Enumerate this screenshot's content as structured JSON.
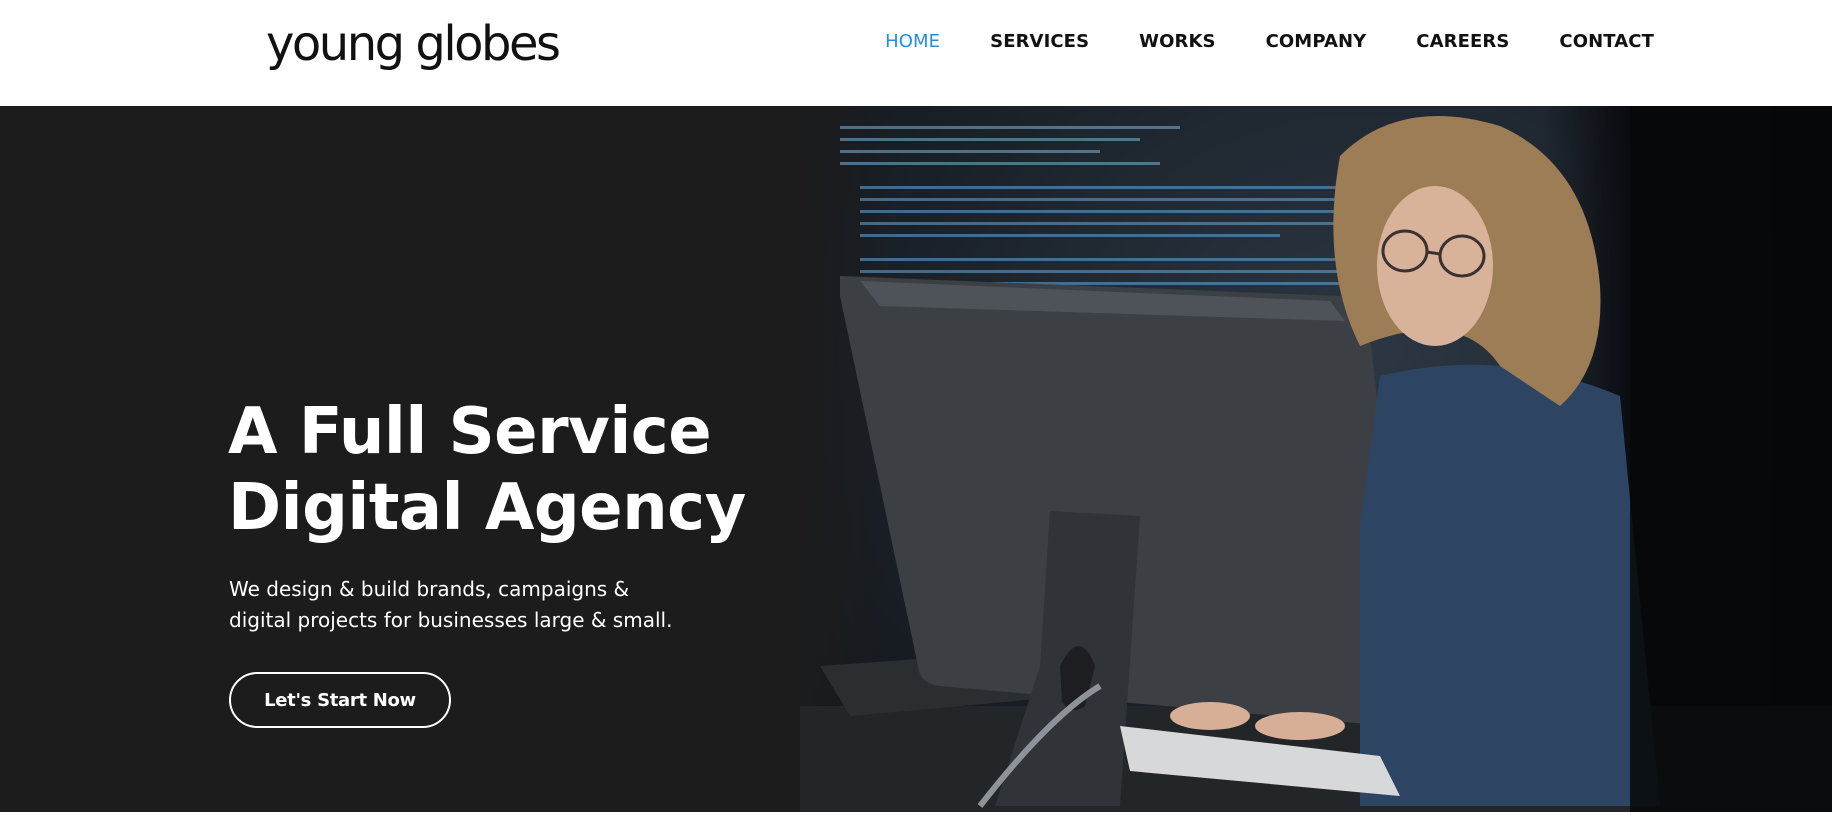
{
  "header": {
    "logo_text": "young globes",
    "nav": [
      {
        "label": "HOME",
        "active": true
      },
      {
        "label": "SERVICES",
        "active": false
      },
      {
        "label": "WORKS",
        "active": false
      },
      {
        "label": "COMPANY",
        "active": false
      },
      {
        "label": "CAREERS",
        "active": false
      },
      {
        "label": "CONTACT",
        "active": false
      }
    ]
  },
  "hero": {
    "title_line1": "A Full Service",
    "title_line2": "Digital Agency",
    "subtitle_line1": "We design & build brands, campaigns &",
    "subtitle_line2": "digital projects for businesses large & small.",
    "cta_label": "Let's Start Now",
    "image_subject": "woman-at-computer-photo"
  },
  "colors": {
    "accent": "#1e90e6",
    "hero_bg": "#1c1c1d",
    "nav_text": "#111111",
    "hero_text": "#ffffff"
  }
}
